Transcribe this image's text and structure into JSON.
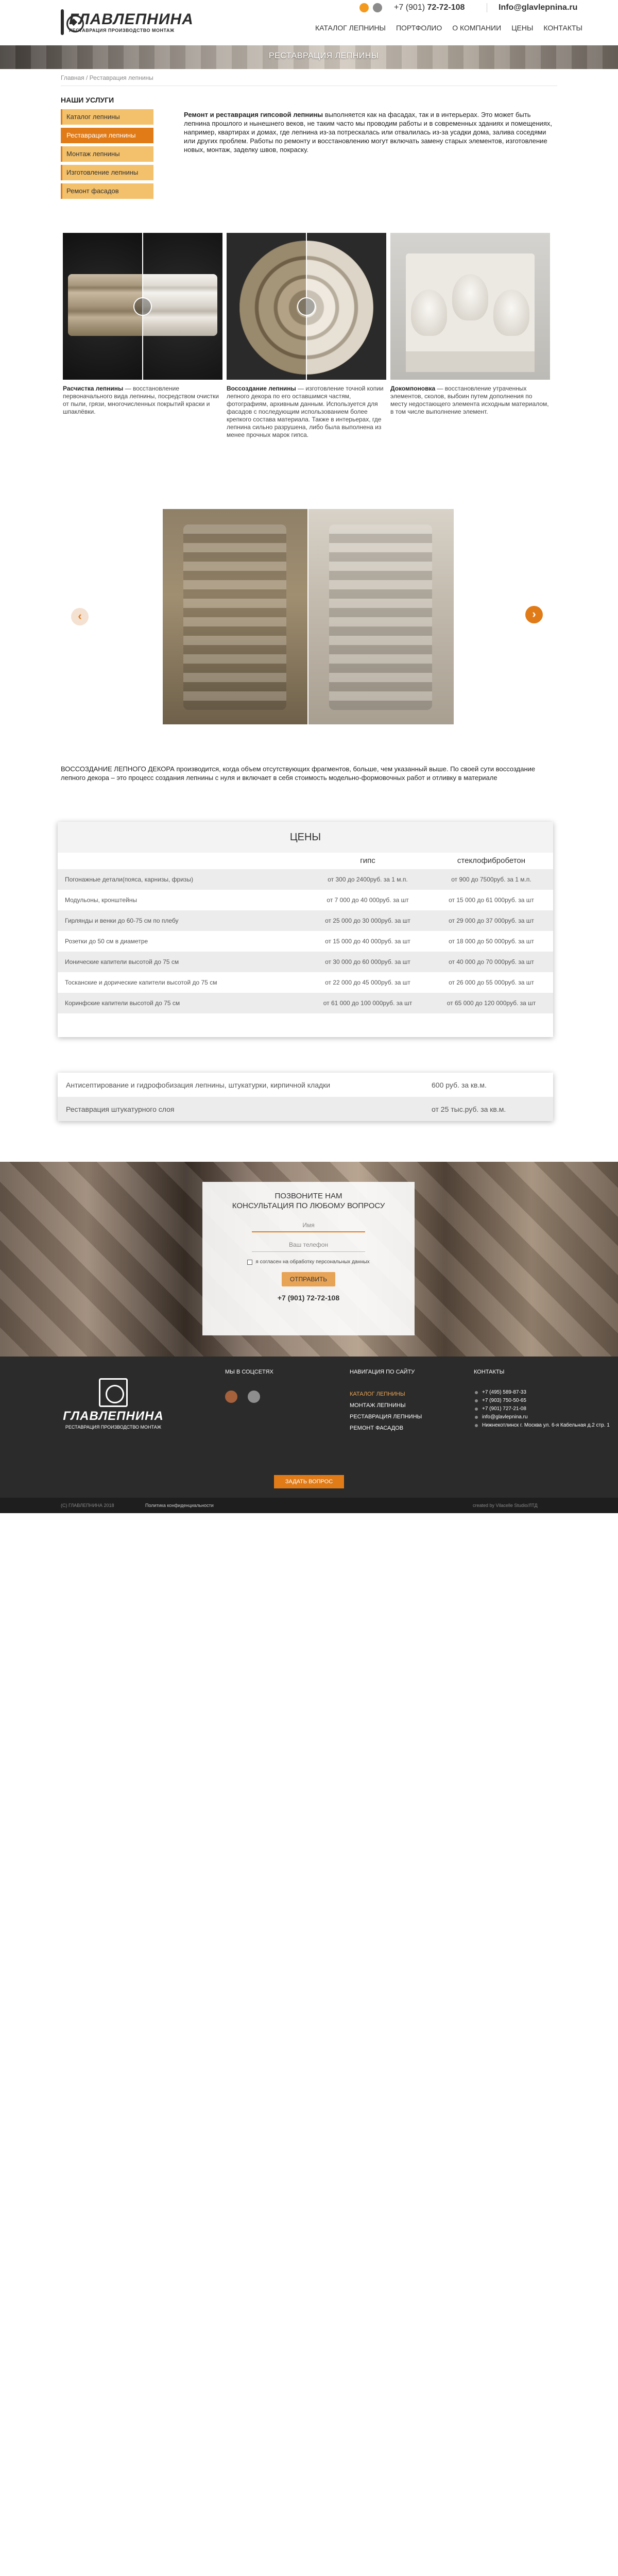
{
  "header": {
    "logo_name": "ГЛАВЛЕПНИНА",
    "logo_tagline": "РЕСТАВРАЦИЯ ПРОИЗВОДСТВО МОНТАЖ",
    "phone_prefix": "+7 (901)",
    "phone_number": "72-72-108",
    "email": "Info@glavlepnina.ru",
    "nav": [
      "КАТАЛОГ ЛЕПНИНЫ",
      "ПОРТФОЛИО",
      "О КОМПАНИИ",
      "ЦЕНЫ",
      "КОНТАКТЫ"
    ]
  },
  "banner": {
    "title": "РЕСТАВРАЦИЯ ЛЕПНИНЫ"
  },
  "breadcrumb": "Главная / Реставрация лепнины",
  "sidebar": {
    "title": "НАШИ УСЛУГИ",
    "items": [
      {
        "label": "Каталог лепнины",
        "active": false
      },
      {
        "label": "Реставрация лепнины",
        "active": true
      },
      {
        "label": "Монтаж лепнины",
        "active": false
      },
      {
        "label": "Изготовление лепнины",
        "active": false
      },
      {
        "label": "Ремонт фасадов",
        "active": false
      }
    ]
  },
  "intro": {
    "bold": "Ремонт и реставрация гипсовой лепнины",
    "text": " выполняется как на фасадах, так и в интерьерах. Это может быть лепнина прошлого и нынешнего веков, не таким часто мы проводим работы и в современных зданиях и помещениях, например, квартирах и домах, где лепнина из-за потрескалась или отвалилась из-за усадки дома, залива соседями или других проблем. Работы по ремонту и восстановлению могут включать замену старых элементов, изготовление новых, монтаж, заделку швов, покраску."
  },
  "services": [
    {
      "title": "Расчистка лепнины",
      "text": " — восстановление первоначального вида лепнины, посредством очистки от пыли, грязи, многочисленных покрытий краски и шпаклёвки."
    },
    {
      "title": "Воссоздание лепнины",
      "text": " — изготовление точной копии лепного декора по его оставшимся частям, фотографиям, архивным данным. Используется для фасадов с последующим использованием более крепкого состава материала. Также в интерьерах, где лепнина сильно разрушена, либо была выполнена из менее прочных марок гипса."
    },
    {
      "title": "Докомпоновка",
      "text": " — восстановление утраченных элементов, сколов, выбоин путем дополнения по месту недостающего элемента исходным материалом, в том числе выполнение элемент."
    }
  ],
  "restore_text": "ВОССОЗДАНИЕ ЛЕПНОГО ДЕКОРА производится, когда объем отсутствующих фрагментов, больше, чем указанный выше. По своей сути воссоздание лепного декора – это процесс создания лепнины с нуля и включает в себя стоимость модельно-формовочных работ и отливку в материале",
  "prices": {
    "title": "ЦЕНЫ",
    "col_a": "гипс",
    "col_b": "стеклофибробетон",
    "rows": [
      {
        "name": "Погонажные детали(пояса, карнизы, фризы)",
        "a": "от 300 до 2400руб. за 1 м.п.",
        "b": "от 900 до 7500руб. за 1 м.п."
      },
      {
        "name": "Модульоны, кронштейны",
        "a": "от 7 000 до 40 000руб. за шт",
        "b": "от 15 000 до 61 000руб. за шт"
      },
      {
        "name": "Гирлянды и венки до 60-75 см по плебу",
        "a": "от 25 000 до 30 000руб. за шт",
        "b": "от 29 000 до 37 000руб. за шт"
      },
      {
        "name": "Розетки до 50 см в диаметре",
        "a": "от 15 000 до 40 000руб. за шт",
        "b": "от 18 000 до 50 000руб. за шт"
      },
      {
        "name": "Ионические капители высотой до 75 см",
        "a": "от 30 000 до 60 000руб. за шт",
        "b": "от 40 000 до 70 000руб. за шт"
      },
      {
        "name": "Тосканские и дорические капители высотой до 75 см",
        "a": "от 22 000 до 45 000руб. за шт",
        "b": "от 26 000 до 55 000руб. за шт"
      },
      {
        "name": "Коринфские капители высотой до 75 см",
        "a": "от 61 000 до 100 000руб. за шт",
        "b": "от 65 000 до 120 000руб. за шт"
      }
    ]
  },
  "extra": [
    {
      "name": "Антисептирование и гидрофобизация лепнины, штукатурки, кирпичной кладки",
      "price": "600 руб. за кв.м."
    },
    {
      "name": "Реставрация штукатурного слоя",
      "price": "от 25 тыс.руб. за кв.м."
    }
  ],
  "callback": {
    "title_line1": "ПОЗВОНИТЕ НАМ",
    "title_line2": "КОНСУЛЬТАЦИЯ ПО ЛЮБОМУ ВОПРОСУ",
    "name_placeholder": "Имя",
    "phone_placeholder": "Ваш телефон",
    "consent": "я согласен на обработку персональных данных",
    "button": "ОТПРАВИТЬ",
    "phone": "+7 (901) 72-72-108"
  },
  "footer": {
    "logo_name": "ГЛАВЛЕПНИНА",
    "logo_tagline": "РЕСТАВРАЦИЯ ПРОИЗВОДСТВО МОНТАЖ",
    "social_title": "МЫ В СОЦСЕТЯХ",
    "nav_title": "НАВИГАЦИЯ ПО САЙТУ",
    "nav": [
      {
        "label": "КАТАЛОГ ЛЕПНИНЫ",
        "active": true
      },
      {
        "label": "МОНТАЖ ЛЕПНИНЫ",
        "active": false
      },
      {
        "label": "РЕСТАВРАЦИЯ ЛЕПНИНЫ",
        "active": false
      },
      {
        "label": "РЕМОНТ ФАСАДОВ",
        "active": false
      }
    ],
    "contacts_title": "КОНТАКТЫ",
    "contacts": [
      "+7 (495) 589-87-33",
      "+7 (903) 750-50-65",
      "+7 (901) 727-21-08",
      "info@glavlepnina.ru",
      "Нижнекотлинск г. Москва ул. 6-я Кабельная д.2 стр. 1"
    ],
    "ask_button": "ЗАДАТЬ ВОПРОС",
    "copyright": "(С) ГЛАВЛЕПНИНА 2018",
    "privacy": "Политика конфиденциальности",
    "developer": "created by Vilacelle Studio/ЛТД"
  },
  "colors": {
    "accent": "#e07b18",
    "accent_light": "#f3c06b",
    "footer_bg": "#2b2b2b"
  }
}
